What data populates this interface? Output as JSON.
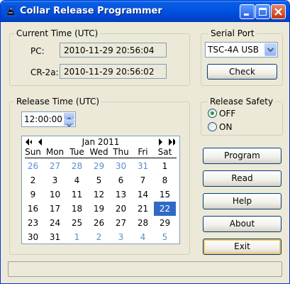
{
  "window": {
    "title": "Collar Release Programmer"
  },
  "current_time": {
    "group_label": "Current Time (UTC)",
    "pc_label": "PC:",
    "pc_value": "2010-11-29  20:56:04",
    "cr_label": "CR-2a:",
    "cr_value": "2010-11-29  20:56:02"
  },
  "serial_port": {
    "group_label": "Serial Port",
    "selected": "TSC-4A USB",
    "check_label": "Check"
  },
  "release_time": {
    "group_label": "Release Time (UTC)",
    "time_value": "12:00:00"
  },
  "release_safety": {
    "group_label": "Release Safety",
    "off_label": "OFF",
    "on_label": "ON",
    "selected": "OFF"
  },
  "calendar": {
    "month_label": "Jan 2011",
    "days_of_week": [
      "Sun",
      "Mon",
      "Tue",
      "Wed",
      "Thu",
      "Fri",
      "Sat"
    ],
    "weeks": [
      [
        "26",
        "27",
        "28",
        "29",
        "30",
        "31",
        "1"
      ],
      [
        "2",
        "3",
        "4",
        "5",
        "6",
        "7",
        "8"
      ],
      [
        "9",
        "10",
        "11",
        "12",
        "13",
        "14",
        "15"
      ],
      [
        "16",
        "17",
        "18",
        "19",
        "20",
        "21",
        "22"
      ],
      [
        "23",
        "24",
        "25",
        "26",
        "27",
        "28",
        "29"
      ],
      [
        "30",
        "31",
        "1",
        "2",
        "3",
        "4",
        "5"
      ]
    ],
    "other_month": [
      [
        true,
        true,
        true,
        true,
        true,
        true,
        false
      ],
      [
        false,
        false,
        false,
        false,
        false,
        false,
        false
      ],
      [
        false,
        false,
        false,
        false,
        false,
        false,
        false
      ],
      [
        false,
        false,
        false,
        false,
        false,
        false,
        false
      ],
      [
        false,
        false,
        false,
        false,
        false,
        false,
        false
      ],
      [
        false,
        false,
        true,
        true,
        true,
        true,
        true
      ]
    ],
    "selected_day": "22"
  },
  "actions": {
    "program_label": "Program",
    "read_label": "Read",
    "help_label": "Help",
    "about_label": "About",
    "exit_label": "Exit"
  },
  "status_bar": {
    "text": ""
  },
  "colors": {
    "titlebar": "#0054e3",
    "face": "#ece9d8",
    "selected_day": "#316ac5",
    "other_month_text": "#5b8ccf"
  }
}
